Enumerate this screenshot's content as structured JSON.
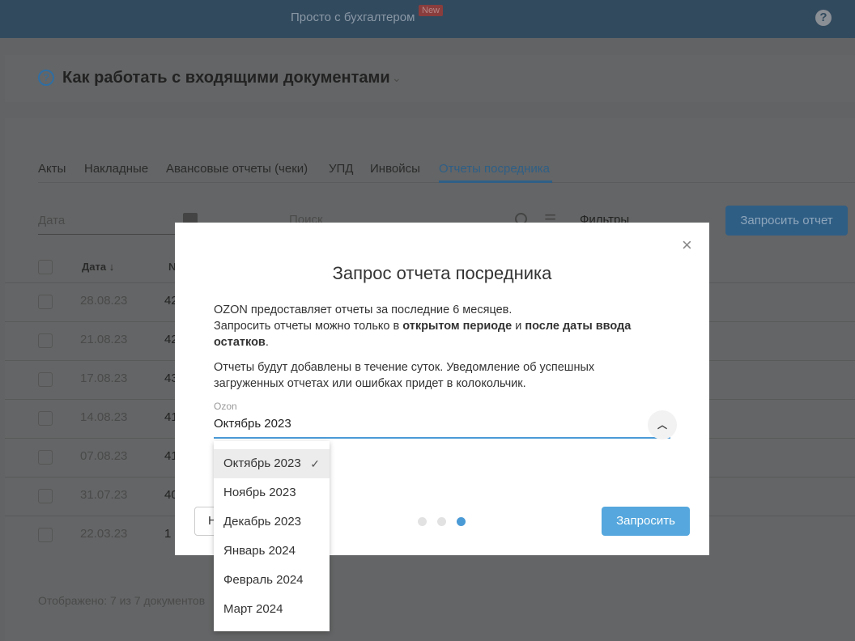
{
  "header": {
    "brand": "Просто с бухгалтером",
    "badge": "New",
    "help": "?"
  },
  "hint": {
    "icon": "?",
    "title": "Как работать с входящими документами",
    "chevron": "⌄"
  },
  "tabs": [
    {
      "label": "Акты"
    },
    {
      "label": "Накладные"
    },
    {
      "label": "Авансовые отчеты (чеки)"
    },
    {
      "label": "УПД"
    },
    {
      "label": "Инвойсы"
    },
    {
      "label": "Отчеты посредника"
    }
  ],
  "filters": {
    "date_placeholder": "Дата",
    "search_placeholder": "Поиск",
    "filters_label": "Фильтры",
    "request_button": "Запросить отчет"
  },
  "table": {
    "headers": {
      "date": "Дата ↓",
      "number": "№"
    },
    "rows": [
      {
        "date": "28.08.23",
        "number": "42"
      },
      {
        "date": "21.08.23",
        "number": "42"
      },
      {
        "date": "17.08.23",
        "number": "43"
      },
      {
        "date": "14.08.23",
        "number": "41"
      },
      {
        "date": "07.08.23",
        "number": "41"
      },
      {
        "date": "31.07.23",
        "number": "40"
      },
      {
        "date": "22.03.23",
        "number": "1"
      }
    ]
  },
  "footer": "Отображено: 7 из 7 документов",
  "modal": {
    "title": "Запрос отчета посредника",
    "close": "×",
    "p1a": "OZON предоставляет отчеты за последние 6 месяцев.",
    "p1b": "Запросить отчеты можно только в ",
    "p1bold1": "открытом периоде",
    "p1c": " и ",
    "p1bold2": "после даты ввода остатков",
    "p1d": ".",
    "p2": "Отчеты будут добавлены в течение суток. Уведомление об успешных загруженных отчетах или ошибках придет в колокольчик.",
    "field_label": "Ozon",
    "field_value": "Октябрь 2023",
    "back": "Назад",
    "submit": "Запросить",
    "steps_total": 3,
    "step_current": 3,
    "options": [
      {
        "label": "Октябрь 2023",
        "selected": true
      },
      {
        "label": "Ноябрь 2023"
      },
      {
        "label": "Декабрь 2023"
      },
      {
        "label": "Январь 2024"
      },
      {
        "label": "Февраль 2024"
      },
      {
        "label": "Март 2024"
      }
    ],
    "check": "✓"
  },
  "colors": {
    "accent": "#55a7dd"
  }
}
